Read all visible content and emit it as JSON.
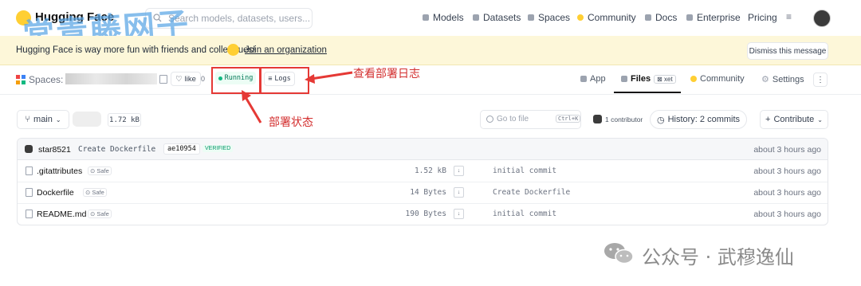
{
  "topnav": {
    "brand": "Hugging Face",
    "search_placeholder": "Search models, datasets, users...",
    "items": [
      "Models",
      "Datasets",
      "Spaces",
      "Community",
      "Docs",
      "Enterprise",
      "Pricing"
    ]
  },
  "watermark_top": "常青藤网子",
  "banner": {
    "text": "Hugging Face is way more fun with friends and colleagues!",
    "link": "Join an organization",
    "dismiss": "Dismiss this message"
  },
  "space": {
    "label": "Spaces:",
    "like": "like",
    "like_count": "0",
    "status": "Running",
    "logs": "Logs",
    "tabs": {
      "app": "App",
      "files": "Files",
      "xet": "xet",
      "community": "Community",
      "settings": "Settings"
    }
  },
  "annotations": {
    "logs": "查看部署日志",
    "status": "部署状态"
  },
  "toolbar": {
    "branch": "main",
    "size": "1.72 kB",
    "goto_placeholder": "Go to file",
    "goto_shortcut": "Ctrl+K",
    "contributors": "1 contributor",
    "history": "History: 2 commits",
    "contribute": "Contribute"
  },
  "commit": {
    "user": "star8521",
    "message": "Create Dockerfile",
    "hash": "ae10954",
    "verified": "VERIFIED",
    "time": "about 3 hours ago"
  },
  "files": [
    {
      "name": ".gitattributes",
      "safe": "Safe",
      "size": "1.52 kB",
      "message": "initial commit",
      "time": "about 3 hours ago"
    },
    {
      "name": "Dockerfile",
      "safe": "Safe",
      "size": "14 Bytes",
      "message": "Create Dockerfile",
      "time": "about 3 hours ago"
    },
    {
      "name": "README.md",
      "safe": "Safe",
      "size": "190 Bytes",
      "message": "initial commit",
      "time": "about 3 hours ago"
    }
  ],
  "footer_watermark": "公众号 · 武穆逸仙",
  "colors": {
    "banner_bg": "#fdf7d9",
    "running_text": "#047857",
    "annotation_red": "#e53935",
    "watermark_blue": "#5aa6e6"
  }
}
